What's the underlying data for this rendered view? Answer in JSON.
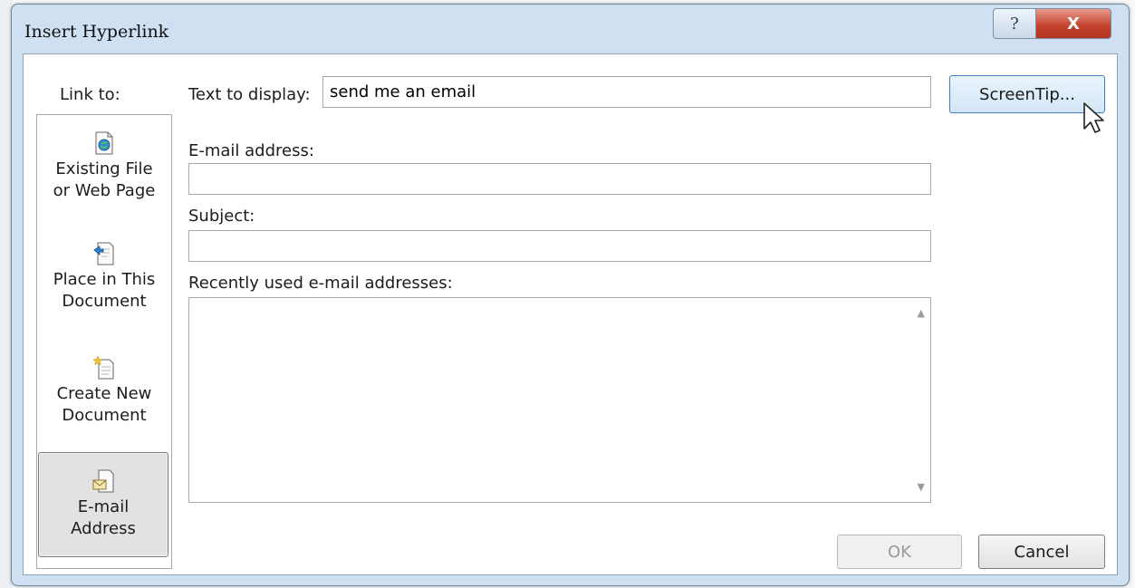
{
  "window": {
    "title": "Insert Hyperlink",
    "help_label": "?",
    "close_label": "X"
  },
  "link_to": {
    "label": "Link to:",
    "items": [
      {
        "line1": "Existing File",
        "line2": "or Web Page",
        "icon": "web-page-icon",
        "accel_index": 1
      },
      {
        "line1": "Place in This",
        "line2": "Document",
        "icon": "bookmark-document-icon",
        "accel_index": 2
      },
      {
        "line1": "Create New",
        "line2": "Document",
        "icon": "new-document-icon",
        "accel_index": 7
      },
      {
        "line1": "E-mail",
        "line2": "Address",
        "icon": "email-address-icon",
        "accel_index": 2,
        "selected": true
      }
    ]
  },
  "text_to_display": {
    "label": "Text to display:",
    "value": "send me an email"
  },
  "email_address": {
    "label": "E-mail address:",
    "value": ""
  },
  "subject": {
    "label": "Subject:",
    "value": ""
  },
  "recent": {
    "label": "Recently used e-mail addresses:",
    "items": []
  },
  "buttons": {
    "screentip": "ScreenTip...",
    "ok": "OK",
    "cancel": "Cancel"
  },
  "colors": {
    "frame": "#cfe0f2",
    "close": "#c4402b",
    "focus": "#3d7fc1"
  }
}
